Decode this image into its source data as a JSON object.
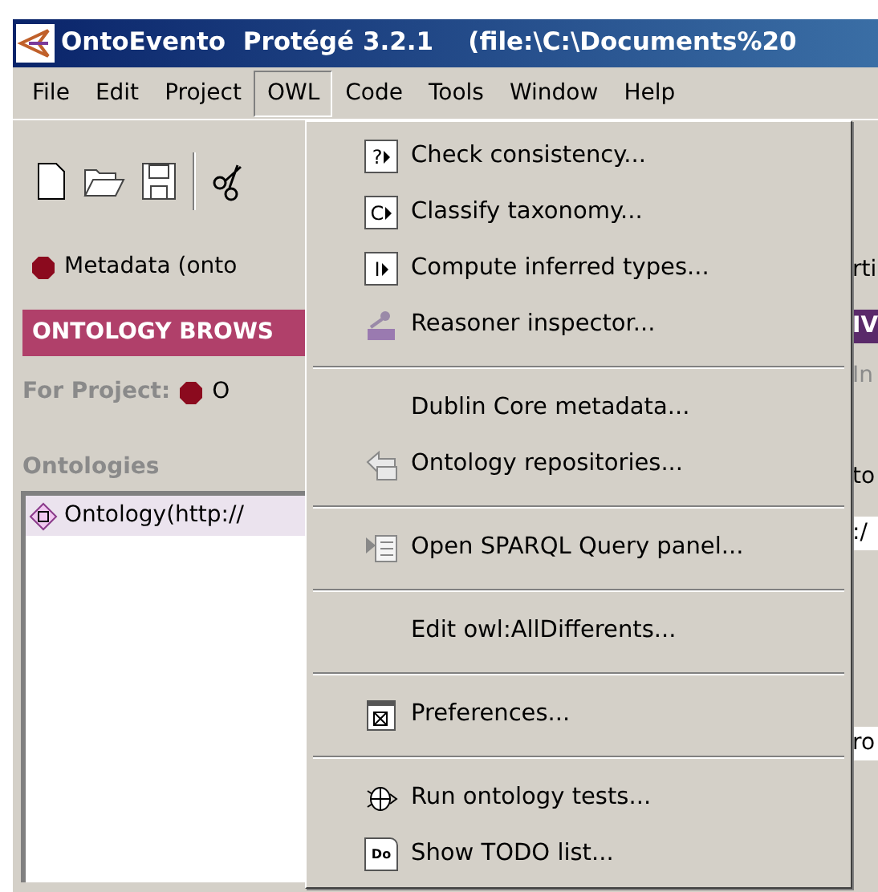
{
  "window": {
    "title": "OntoEvento  Protégé 3.2.1    (file:\\C:\\Documents%20"
  },
  "menu_bar": [
    {
      "label": "File",
      "selected": false
    },
    {
      "label": "Edit",
      "selected": false
    },
    {
      "label": "Project",
      "selected": false
    },
    {
      "label": "OWL",
      "selected": true
    },
    {
      "label": "Code",
      "selected": false
    },
    {
      "label": "Tools",
      "selected": false
    },
    {
      "label": "Window",
      "selected": false
    },
    {
      "label": "Help",
      "selected": false
    }
  ],
  "left_panel": {
    "tab": "Metadata (onto",
    "header": "ONTOLOGY BROWS",
    "project_label": "For Project:",
    "project_value": "O",
    "section": "Ontologies",
    "list": [
      {
        "label": "Ontology(http://",
        "selected": true
      }
    ]
  },
  "right_panel": {
    "fragments": [
      "rti",
      "IV",
      "In",
      "to",
      ":/",
      "ro"
    ]
  },
  "owl_menu": [
    {
      "kind": "item",
      "label": "Check consistency...",
      "icon_text": "?"
    },
    {
      "kind": "item",
      "label": "Classify taxonomy...",
      "icon_text": "C"
    },
    {
      "kind": "item",
      "label": "Compute inferred types...",
      "icon_text": "I"
    },
    {
      "kind": "item",
      "label": "Reasoner inspector..."
    },
    {
      "kind": "separator"
    },
    {
      "kind": "item",
      "label": "Dublin Core metadata..."
    },
    {
      "kind": "item",
      "label": "Ontology repositories..."
    },
    {
      "kind": "separator"
    },
    {
      "kind": "item",
      "label": "Open SPARQL Query panel..."
    },
    {
      "kind": "separator"
    },
    {
      "kind": "item",
      "label": "Edit owl:AllDifferents..."
    },
    {
      "kind": "separator"
    },
    {
      "kind": "item",
      "label": "Preferences..."
    },
    {
      "kind": "separator"
    },
    {
      "kind": "item",
      "label": "Run ontology tests..."
    },
    {
      "kind": "item",
      "label": "Show TODO list...",
      "icon_text": "Do"
    }
  ]
}
